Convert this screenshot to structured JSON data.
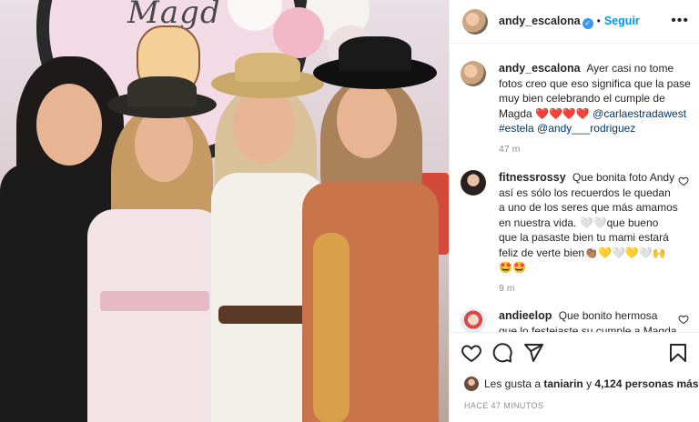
{
  "post": {
    "author": "andy_escalona",
    "follow_label": "Seguir",
    "dot": "•",
    "more_glyph": "•••",
    "photo_banner": "Magd"
  },
  "caption": {
    "user": "andy_escalona",
    "text": "Ayer casi no tome fotos creo que eso significa que la pase muy bien celebrando el cumple de Magda ❤️❤️❤️❤️",
    "mentions": [
      "@carlaestradawest",
      "#estela",
      "@andy___rodriguez"
    ],
    "time": "47 m"
  },
  "comments": [
    {
      "user": "fitnessrossy",
      "text": "Que bonita foto Andy así es sólo los recuerdos le quedan a uno de los seres que más amamos en nuestra vida. 🤍🤍que bueno que la pasaste bien tu mami estará feliz de verte bien👏🏽💛🤍💛🤍🙌 🤩🤩",
      "time": "9 m"
    },
    {
      "user": "andieelop",
      "text": "Que bonito hermosa que lo festejaste su cumple a Magda"
    }
  ],
  "likes": {
    "prefix": "Les gusta a",
    "user": "taniarin",
    "middle": "y",
    "count": "4,124 personas más"
  },
  "timestamp": "HACE 47 MINUTOS",
  "colors": {
    "follow": "#0095f6",
    "verified": "#3897f0",
    "mention": "#00376b",
    "muted": "#8e8e8e"
  }
}
